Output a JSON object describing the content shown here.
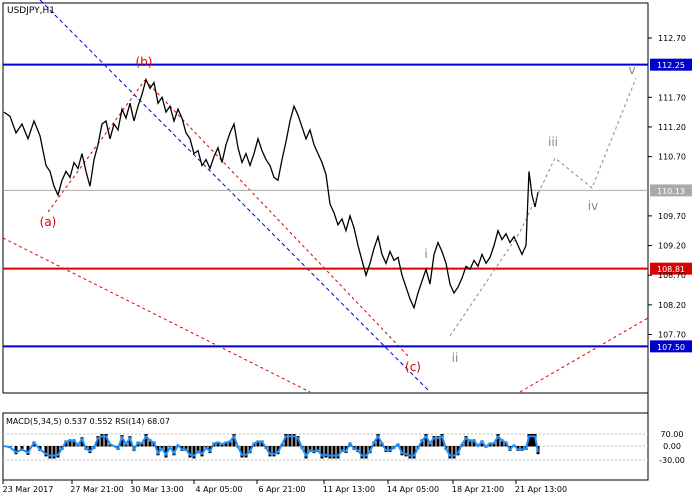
{
  "chart_data": {
    "type": "line",
    "symbol_label": "USDJPY,H1",
    "price_axis": {
      "min": 107.2,
      "max": 112.95,
      "ticks": [
        "112.70",
        "112.25",
        "111.70",
        "111.20",
        "110.70",
        "110.13",
        "109.70",
        "109.20",
        "108.81",
        "108.70",
        "108.20",
        "107.70",
        "107.50"
      ]
    },
    "time_axis": {
      "labels": [
        "23 Mar 2017",
        "27 Mar 21:00",
        "30 Mar 13:00",
        "4 Apr 05:00",
        "6 Apr 21:00",
        "11 Apr 13:00",
        "14 Apr 05:00",
        "18 Apr 21:00",
        "21 Apr 13:00"
      ]
    },
    "levels": [
      {
        "price": 112.25,
        "label": "112.25",
        "color": "#0000cc"
      },
      {
        "price": 108.81,
        "label": "108.81",
        "color": "#dd0000"
      },
      {
        "price": 107.5,
        "label": "107.50",
        "color": "#0000cc"
      },
      {
        "price": 110.13,
        "label": "110.13",
        "color": "#aaaaaa"
      }
    ],
    "price_series": [
      [
        0,
        111.45
      ],
      [
        6,
        111.38
      ],
      [
        12,
        111.1
      ],
      [
        18,
        111.25
      ],
      [
        24,
        111.0
      ],
      [
        30,
        111.3
      ],
      [
        36,
        111.05
      ],
      [
        42,
        110.55
      ],
      [
        46,
        110.45
      ],
      [
        50,
        110.2
      ],
      [
        54,
        110.05
      ],
      [
        58,
        110.3
      ],
      [
        62,
        110.45
      ],
      [
        66,
        110.35
      ],
      [
        70,
        110.6
      ],
      [
        74,
        110.5
      ],
      [
        78,
        110.75
      ],
      [
        82,
        110.45
      ],
      [
        86,
        110.2
      ],
      [
        90,
        110.65
      ],
      [
        94,
        110.9
      ],
      [
        98,
        111.25
      ],
      [
        102,
        111.3
      ],
      [
        106,
        111.0
      ],
      [
        110,
        111.25
      ],
      [
        114,
        111.15
      ],
      [
        118,
        111.5
      ],
      [
        122,
        111.35
      ],
      [
        126,
        111.6
      ],
      [
        130,
        111.3
      ],
      [
        134,
        111.55
      ],
      [
        138,
        111.75
      ],
      [
        142,
        112.0
      ],
      [
        146,
        111.85
      ],
      [
        150,
        111.95
      ],
      [
        154,
        111.6
      ],
      [
        158,
        111.7
      ],
      [
        162,
        111.45
      ],
      [
        166,
        111.55
      ],
      [
        170,
        111.3
      ],
      [
        174,
        111.5
      ],
      [
        178,
        111.35
      ],
      [
        182,
        111.1
      ],
      [
        186,
        111.0
      ],
      [
        190,
        110.75
      ],
      [
        194,
        110.8
      ],
      [
        198,
        110.55
      ],
      [
        202,
        110.65
      ],
      [
        206,
        110.5
      ],
      [
        210,
        110.7
      ],
      [
        214,
        110.85
      ],
      [
        218,
        110.6
      ],
      [
        222,
        110.9
      ],
      [
        226,
        111.1
      ],
      [
        230,
        111.25
      ],
      [
        234,
        110.85
      ],
      [
        238,
        110.6
      ],
      [
        242,
        110.75
      ],
      [
        246,
        110.55
      ],
      [
        250,
        110.75
      ],
      [
        254,
        111.0
      ],
      [
        258,
        110.8
      ],
      [
        262,
        110.65
      ],
      [
        266,
        110.55
      ],
      [
        270,
        110.35
      ],
      [
        274,
        110.3
      ],
      [
        278,
        110.65
      ],
      [
        282,
        110.95
      ],
      [
        286,
        111.3
      ],
      [
        290,
        111.55
      ],
      [
        294,
        111.4
      ],
      [
        298,
        111.2
      ],
      [
        302,
        111.0
      ],
      [
        306,
        111.15
      ],
      [
        310,
        110.9
      ],
      [
        314,
        110.75
      ],
      [
        318,
        110.6
      ],
      [
        322,
        110.4
      ],
      [
        326,
        109.9
      ],
      [
        330,
        109.75
      ],
      [
        334,
        109.55
      ],
      [
        338,
        109.65
      ],
      [
        342,
        109.45
      ],
      [
        346,
        109.7
      ],
      [
        350,
        109.5
      ],
      [
        354,
        109.2
      ],
      [
        358,
        108.95
      ],
      [
        362,
        108.7
      ],
      [
        366,
        108.9
      ],
      [
        370,
        109.15
      ],
      [
        374,
        109.35
      ],
      [
        378,
        109.05
      ],
      [
        382,
        108.9
      ],
      [
        386,
        109.1
      ],
      [
        390,
        108.95
      ],
      [
        394,
        109.0
      ],
      [
        398,
        108.7
      ],
      [
        402,
        108.5
      ],
      [
        406,
        108.3
      ],
      [
        410,
        108.15
      ],
      [
        414,
        108.4
      ],
      [
        418,
        108.6
      ],
      [
        422,
        108.8
      ],
      [
        426,
        108.55
      ],
      [
        430,
        109.05
      ],
      [
        434,
        109.25
      ],
      [
        438,
        109.1
      ],
      [
        442,
        108.9
      ],
      [
        446,
        108.55
      ],
      [
        450,
        108.4
      ],
      [
        454,
        108.5
      ],
      [
        458,
        108.65
      ],
      [
        462,
        108.85
      ],
      [
        466,
        108.8
      ],
      [
        470,
        108.95
      ],
      [
        474,
        108.85
      ],
      [
        478,
        109.05
      ],
      [
        482,
        108.9
      ],
      [
        486,
        109.0
      ],
      [
        490,
        109.2
      ],
      [
        494,
        109.45
      ],
      [
        498,
        109.3
      ],
      [
        502,
        109.4
      ],
      [
        506,
        109.25
      ],
      [
        510,
        109.35
      ],
      [
        514,
        109.2
      ],
      [
        518,
        109.05
      ],
      [
        522,
        109.2
      ],
      [
        525,
        110.45
      ],
      [
        528,
        110.05
      ],
      [
        531,
        109.85
      ],
      [
        534,
        110.1
      ]
    ]
  },
  "wave_labels": [
    "(a)",
    "(b)",
    "(c)",
    "i",
    "ii",
    "iii",
    "iv",
    "v"
  ],
  "indicator": {
    "title": "MACD(5,34,5) 0.537 0.552 RSI(14) 68.07",
    "ticks": [
      "70.00",
      "0.00",
      "-30.00"
    ]
  },
  "colors": {
    "background": "#ffffff",
    "price": "#000000",
    "macd_line": "#1e90ff",
    "histogram": "#000000",
    "blue_line": "#0000cc",
    "red_line": "#dd0000",
    "forecast": "#888888",
    "label_box": "#0000cc",
    "label_box_red": "#dd0000",
    "wave_red": "#dd0000",
    "wave_gray": "#888888"
  }
}
